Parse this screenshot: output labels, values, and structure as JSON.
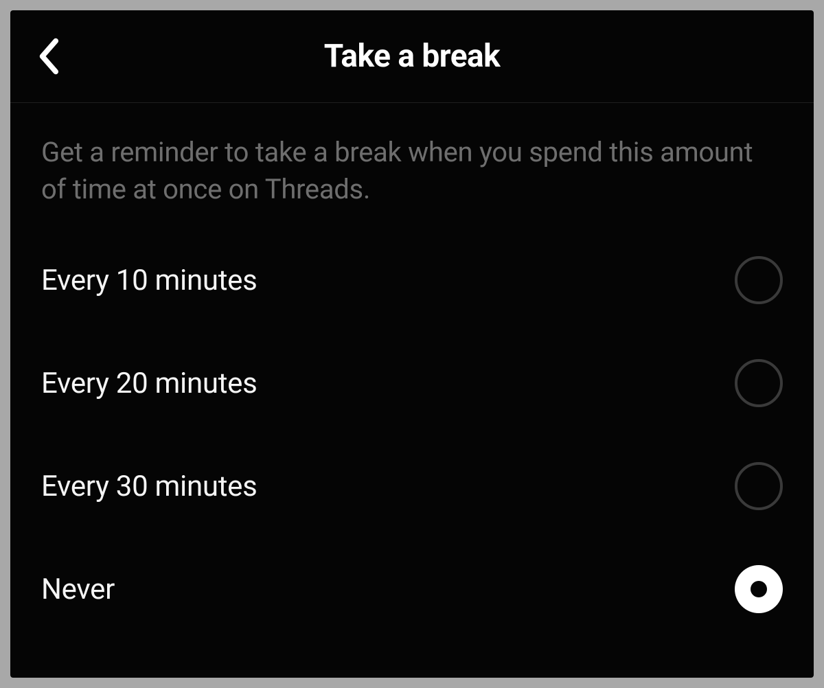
{
  "header": {
    "title": "Take a break"
  },
  "description": "Get a reminder to take a break when you spend this amount of time at once on Threads.",
  "options": [
    {
      "label": "Every 10 minutes",
      "selected": false
    },
    {
      "label": "Every 20 minutes",
      "selected": false
    },
    {
      "label": "Every 30 minutes",
      "selected": false
    },
    {
      "label": "Never",
      "selected": true
    }
  ]
}
